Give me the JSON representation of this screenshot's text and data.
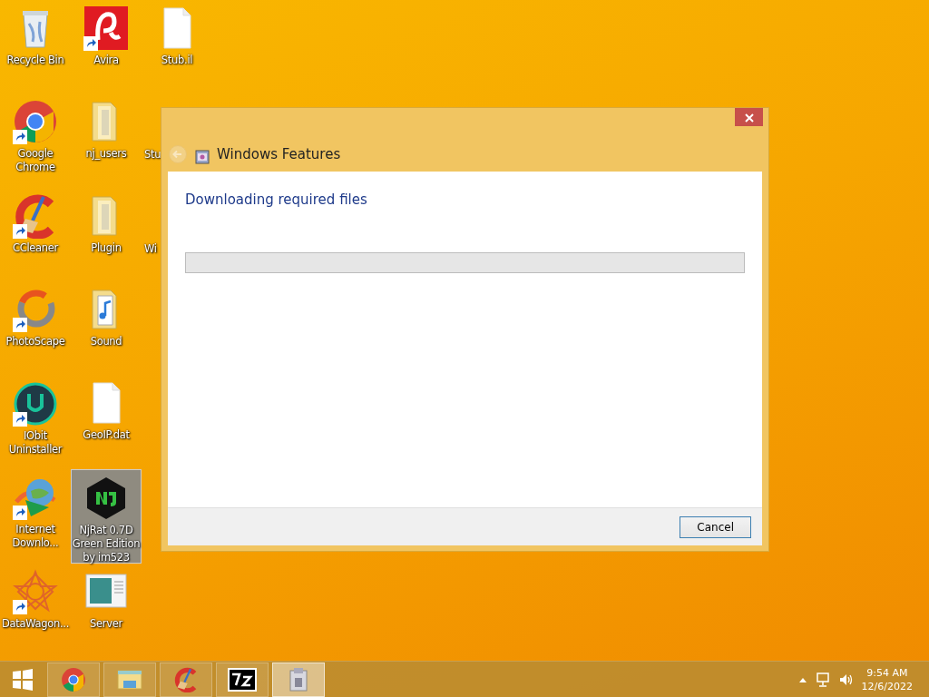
{
  "desktop": {
    "columns": [
      [
        {
          "label": "Recycle Bin",
          "kind": "recycle-bin",
          "shortcut": false,
          "selected": false
        },
        {
          "label": "Google Chrome",
          "kind": "chrome",
          "shortcut": true,
          "selected": false
        },
        {
          "label": "CCleaner",
          "kind": "ccleaner",
          "shortcut": true,
          "selected": false
        },
        {
          "label": "PhotoScape",
          "kind": "photoscape",
          "shortcut": true,
          "selected": false
        },
        {
          "label": "IObit Uninstaller",
          "kind": "iobit",
          "shortcut": true,
          "selected": false
        },
        {
          "label": "Internet Downlo...",
          "kind": "globe",
          "shortcut": true,
          "selected": false
        },
        {
          "label": "DataWagon...",
          "kind": "star",
          "shortcut": true,
          "selected": false
        }
      ],
      [
        {
          "label": "Avira",
          "kind": "avira",
          "shortcut": true,
          "selected": false
        },
        {
          "label": "nj_users",
          "kind": "folder",
          "shortcut": false,
          "selected": false
        },
        {
          "label": "Plugin",
          "kind": "folder",
          "shortcut": false,
          "selected": false
        },
        {
          "label": "Sound",
          "kind": "music-folder",
          "shortcut": false,
          "selected": false
        },
        {
          "label": "GeoIP.dat",
          "kind": "file",
          "shortcut": false,
          "selected": false
        },
        {
          "label": "NjRat 0.7D Green Edition by im523",
          "kind": "hexagon",
          "shortcut": false,
          "selected": true
        },
        {
          "label": "Server",
          "kind": "window",
          "shortcut": false,
          "selected": false
        }
      ],
      [
        {
          "label": "Stub.il",
          "kind": "file",
          "shortcut": false,
          "selected": false
        },
        {
          "label": "Stu",
          "kind": "hidden",
          "shortcut": false,
          "selected": false
        },
        {
          "label": "Wi",
          "kind": "hidden",
          "shortcut": false,
          "selected": false
        }
      ]
    ]
  },
  "dialog": {
    "title": "Windows Features",
    "back_disabled": true,
    "heading": "Downloading required files",
    "progress": {
      "level": 0
    },
    "buttons": [
      "Cancel"
    ]
  },
  "taskbar": {
    "items": [
      {
        "kind": "start",
        "selected": false
      },
      {
        "kind": "chrome",
        "selected": false
      },
      {
        "kind": "explorer",
        "selected": false
      },
      {
        "kind": "ccleaner",
        "selected": false
      },
      {
        "kind": "sevenzip",
        "selected": false
      },
      {
        "kind": "installer",
        "selected": true
      }
    ],
    "tray": {
      "time": "9:54 AM",
      "date": "12/6/2022"
    }
  }
}
